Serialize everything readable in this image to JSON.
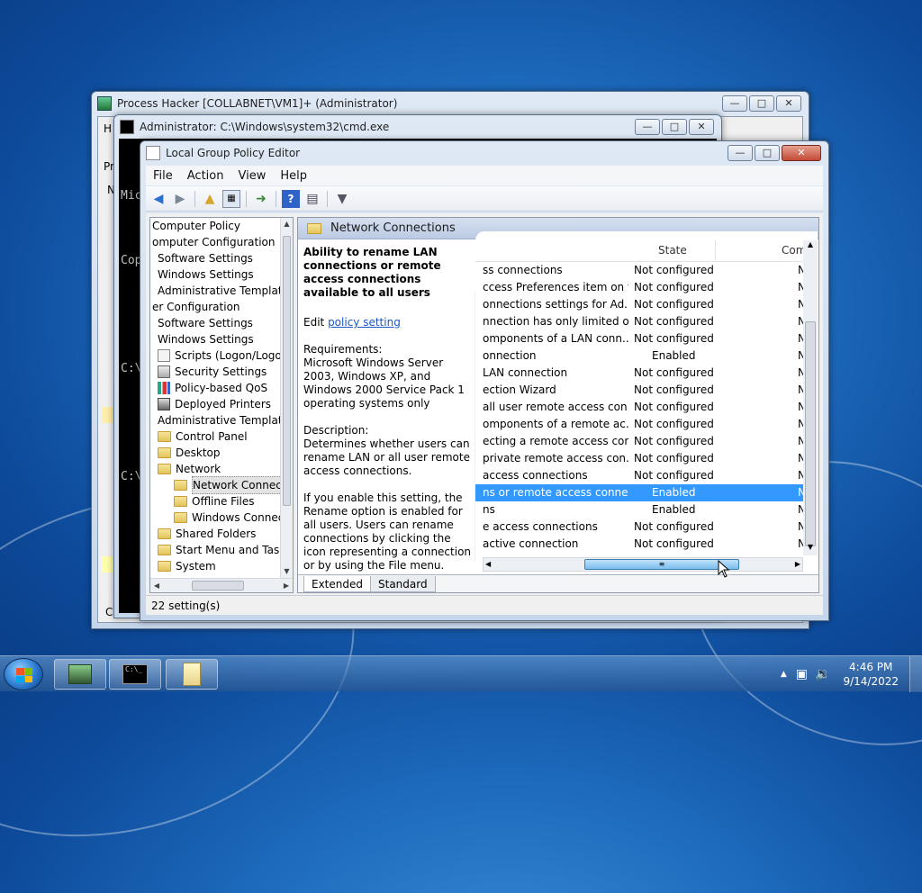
{
  "colors": {
    "accent": "#3399ff",
    "link": "#1a56c8",
    "close_button": "#c24a36"
  },
  "process_hacker": {
    "title": "Process Hacker [COLLABNET\\VM1]+ (Administrator)",
    "status_text": "CPU Usa",
    "partial_menu": "H",
    "partial_tab": "Pr",
    "partial_row": "N"
  },
  "cmd": {
    "title": "Administrator: C:\\Windows\\system32\\cmd.exe",
    "lines": [
      "Mic",
      "Cop",
      "",
      "C:\\",
      "",
      "C:\\"
    ]
  },
  "gpe": {
    "title": "Local Group Policy Editor",
    "menu": [
      "File",
      "Action",
      "View",
      "Help"
    ],
    "toolbar_icons": [
      "back-icon",
      "forward-icon",
      "up-folder-icon",
      "show-hide-tree-icon",
      "export-list-icon",
      "help-icon",
      "properties-icon",
      "filter-icon"
    ],
    "tree": [
      {
        "label": "Computer Policy",
        "indent": 0,
        "icon": "none"
      },
      {
        "label": "omputer Configuration",
        "indent": 0,
        "icon": "none"
      },
      {
        "label": "Software Settings",
        "indent": 1,
        "icon": "none"
      },
      {
        "label": "Windows Settings",
        "indent": 1,
        "icon": "none"
      },
      {
        "label": "Administrative Template",
        "indent": 1,
        "icon": "none"
      },
      {
        "label": "er Configuration",
        "indent": 0,
        "icon": "none"
      },
      {
        "label": "Software Settings",
        "indent": 1,
        "icon": "none"
      },
      {
        "label": "Windows Settings",
        "indent": 1,
        "icon": "none"
      },
      {
        "label": "Scripts (Logon/Logof",
        "indent": 2,
        "icon": "script-icon"
      },
      {
        "label": "Security Settings",
        "indent": 2,
        "icon": "security-icon"
      },
      {
        "label": "Policy-based QoS",
        "indent": 2,
        "icon": "chart-icon"
      },
      {
        "label": "Deployed Printers",
        "indent": 2,
        "icon": "printer-icon"
      },
      {
        "label": "Administrative Template",
        "indent": 1,
        "icon": "none"
      },
      {
        "label": "Control Panel",
        "indent": 2,
        "icon": "folder-icon"
      },
      {
        "label": "Desktop",
        "indent": 2,
        "icon": "folder-icon"
      },
      {
        "label": "Network",
        "indent": 2,
        "icon": "folder-icon"
      },
      {
        "label": "Network Connect",
        "indent": 3,
        "icon": "folder-icon",
        "selected": true
      },
      {
        "label": "Offline Files",
        "indent": 3,
        "icon": "folder-icon"
      },
      {
        "label": "Windows Connec",
        "indent": 3,
        "icon": "folder-icon"
      },
      {
        "label": "Shared Folders",
        "indent": 2,
        "icon": "folder-icon"
      },
      {
        "label": "Start Menu and Taskb",
        "indent": 2,
        "icon": "folder-icon"
      },
      {
        "label": "System",
        "indent": 2,
        "icon": "folder-icon"
      }
    ],
    "pane_header": "Network Connections",
    "description": {
      "title": "Ability to rename LAN connections or remote access connections available to all users",
      "edit_prefix": "Edit ",
      "edit_link": "policy setting ",
      "requirements": "Requirements:\nMicrosoft Windows Server 2003, Windows XP, and Windows 2000 Service Pack 1 operating systems only",
      "description": "Description:\nDetermines whether users can rename LAN or all user remote access connections.",
      "detail": "If you enable this setting, the Rename option is enabled for all users. Users can rename connections by clicking the icon representing a connection or by using the File menu."
    },
    "columns": {
      "state": "State",
      "comment": "Com"
    },
    "settings": [
      {
        "name": "ss connections",
        "state": "Not configured",
        "comment": "N"
      },
      {
        "name": "ccess Preferences item on t...",
        "state": "Not configured",
        "comment": "N"
      },
      {
        "name": "onnections settings for Ad...",
        "state": "Not configured",
        "comment": "N"
      },
      {
        "name": "nnection has only limited or...",
        "state": "Not configured",
        "comment": "N"
      },
      {
        "name": "omponents of a LAN conn...",
        "state": "Not configured",
        "comment": "N"
      },
      {
        "name": "onnection",
        "state": "Enabled",
        "comment": "N"
      },
      {
        "name": " LAN connection",
        "state": "Not configured",
        "comment": "N"
      },
      {
        "name": "ection Wizard",
        "state": "Not configured",
        "comment": "N"
      },
      {
        "name": " all user remote access con...",
        "state": "Not configured",
        "comment": "N"
      },
      {
        "name": "omponents of a remote ac...",
        "state": "Not configured",
        "comment": "N"
      },
      {
        "name": "ecting a remote access con...",
        "state": "Not configured",
        "comment": "N"
      },
      {
        "name": " private remote access con...",
        "state": "Not configured",
        "comment": "N"
      },
      {
        "name": " access connections",
        "state": "Not configured",
        "comment": "N"
      },
      {
        "name": "ns or remote access conne...",
        "state": "Enabled",
        "comment": "N",
        "selected": true
      },
      {
        "name": "ns",
        "state": "Enabled",
        "comment": "N"
      },
      {
        "name": "e access connections",
        "state": "Not configured",
        "comment": "N"
      },
      {
        "name": "active connection",
        "state": "Not configured",
        "comment": "N"
      }
    ],
    "tabs": [
      "Extended",
      "Standard"
    ],
    "status": "22 setting(s)"
  },
  "taskbar": {
    "items": [
      "process-hacker-icon",
      "cmd-icon",
      "notepad-icon"
    ],
    "time": "4:46 PM",
    "date": "9/14/2022"
  }
}
